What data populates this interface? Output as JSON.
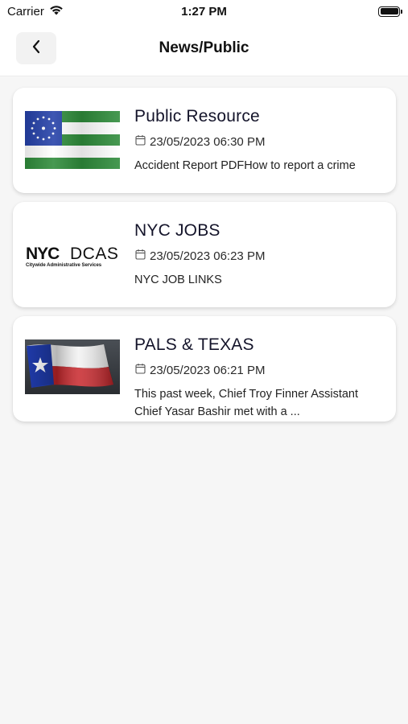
{
  "status_bar": {
    "carrier": "Carrier",
    "time": "1:27 PM"
  },
  "nav": {
    "title": "News/Public",
    "back_icon": "chevron-left-icon"
  },
  "posts": [
    {
      "title": "Public Resource",
      "date": "23/05/2023 06:30 PM",
      "description": "Accident Report PDFHow to report a crime",
      "image": "nyc-flag"
    },
    {
      "title": "NYC JOBS",
      "date": "23/05/2023 06:23 PM",
      "description": "NYC JOB LINKS",
      "image": "nyc-dcas-logo",
      "logo_text_main": "NYC",
      "logo_text_accent": "DCAS",
      "logo_subtext": "Citywide Administrative Services"
    },
    {
      "title": "PALS & TEXAS",
      "date": "23/05/2023 06:21 PM",
      "description": "This past week, Chief Troy Finner  Assistant Chief Yasar Bashir met with a ...",
      "image": "texas-flag"
    }
  ],
  "colors": {
    "background": "#f6f6f6",
    "card": "#ffffff",
    "flag_green": "#2e7d32",
    "flag_blue": "#1f3aa8",
    "texas_red": "#c8262b",
    "dcas_cyan": "#29b6d8"
  }
}
